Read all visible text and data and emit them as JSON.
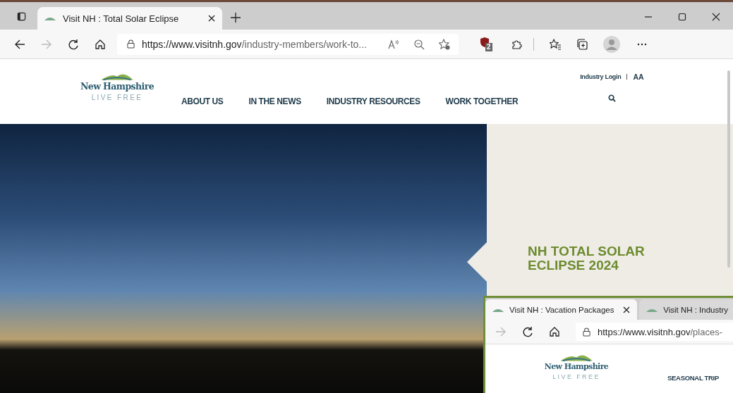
{
  "browser": {
    "tabs": [
      {
        "title": "Visit NH : Total Solar Eclipse",
        "selected": true
      }
    ],
    "url": {
      "host": "https://www.visitnh.gov",
      "path": "/industry-members/work-to..."
    },
    "extension_badge": "2"
  },
  "site": {
    "logo": {
      "name": "New Hampshire",
      "tagline": "LIVE FREE"
    },
    "utility": {
      "login": "Industry Login",
      "text_size": "AA"
    },
    "nav": [
      {
        "label": "ABOUT US"
      },
      {
        "label": "IN THE NEWS"
      },
      {
        "label": "INDUSTRY RESOURCES"
      },
      {
        "label": "WORK TOGETHER"
      }
    ],
    "hero": {
      "heading": "NH TOTAL SOLAR ECLIPSE 2024"
    }
  },
  "second_window": {
    "tabs": [
      {
        "title": "Visit NH : Vacation Packages",
        "selected": true
      },
      {
        "title": "Visit NH : Industry",
        "selected": false
      }
    ],
    "url": {
      "host": "https://www.visitnh.gov",
      "path": "/places-"
    },
    "logo": {
      "name": "New Hampshire",
      "tagline": "LIVE FREE"
    },
    "nav": [
      {
        "label": "SEASONAL TRIP"
      }
    ]
  }
}
